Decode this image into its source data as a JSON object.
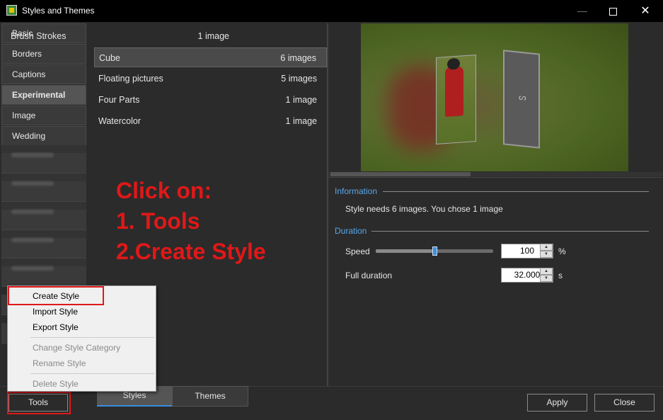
{
  "window": {
    "title": "Styles and Themes"
  },
  "categories": [
    {
      "label": "Basic"
    },
    {
      "label": "Borders"
    },
    {
      "label": "Captions"
    },
    {
      "label": "Experimental"
    },
    {
      "label": "Image"
    },
    {
      "label": "Wedding"
    }
  ],
  "styles": [
    {
      "name": "Brush Strokes",
      "count": "1 image"
    },
    {
      "name": "Cube",
      "count": "6 images"
    },
    {
      "name": "Floating pictures",
      "count": "5 images"
    },
    {
      "name": "Four Parts",
      "count": "1 image"
    },
    {
      "name": "Watercolor",
      "count": "1 image"
    }
  ],
  "annotation": {
    "line1": "Click on:",
    "line2": "1. Tools",
    "line3": "2.Create Style"
  },
  "info": {
    "heading": "Information",
    "text": "Style needs 6 images. You chose 1 image"
  },
  "duration": {
    "heading": "Duration",
    "speed_label": "Speed",
    "speed_value": "100",
    "speed_unit": "%",
    "speed_fraction": 0.5,
    "full_label": "Full duration",
    "full_value": "32.000",
    "full_unit": "s"
  },
  "menu": {
    "create": "Create Style",
    "import": "Import Style",
    "export": "Export Style",
    "change": "Change Style Category",
    "rename": "Rename Style",
    "delete": "Delete Style"
  },
  "tabs": {
    "styles": "Styles",
    "themes": "Themes"
  },
  "buttons": {
    "tools": "Tools",
    "apply": "Apply",
    "close": "Close"
  },
  "colors": {
    "accent": "#3a8ee0",
    "annotation": "#e01818",
    "heading": "#5aa6e8"
  }
}
